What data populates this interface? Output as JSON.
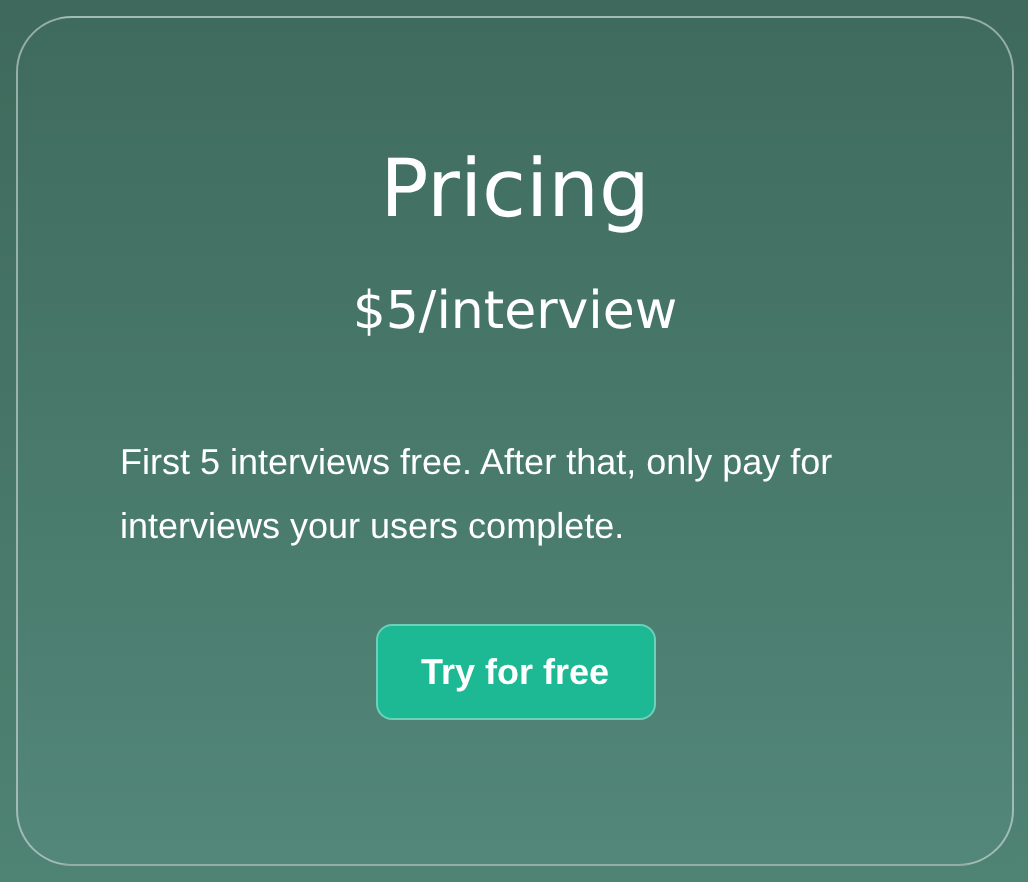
{
  "card": {
    "title": "Pricing",
    "price": "$5/interview",
    "description": "First 5 interviews free. After that, only pay for interviews your users complete.",
    "button": "Try for free"
  }
}
